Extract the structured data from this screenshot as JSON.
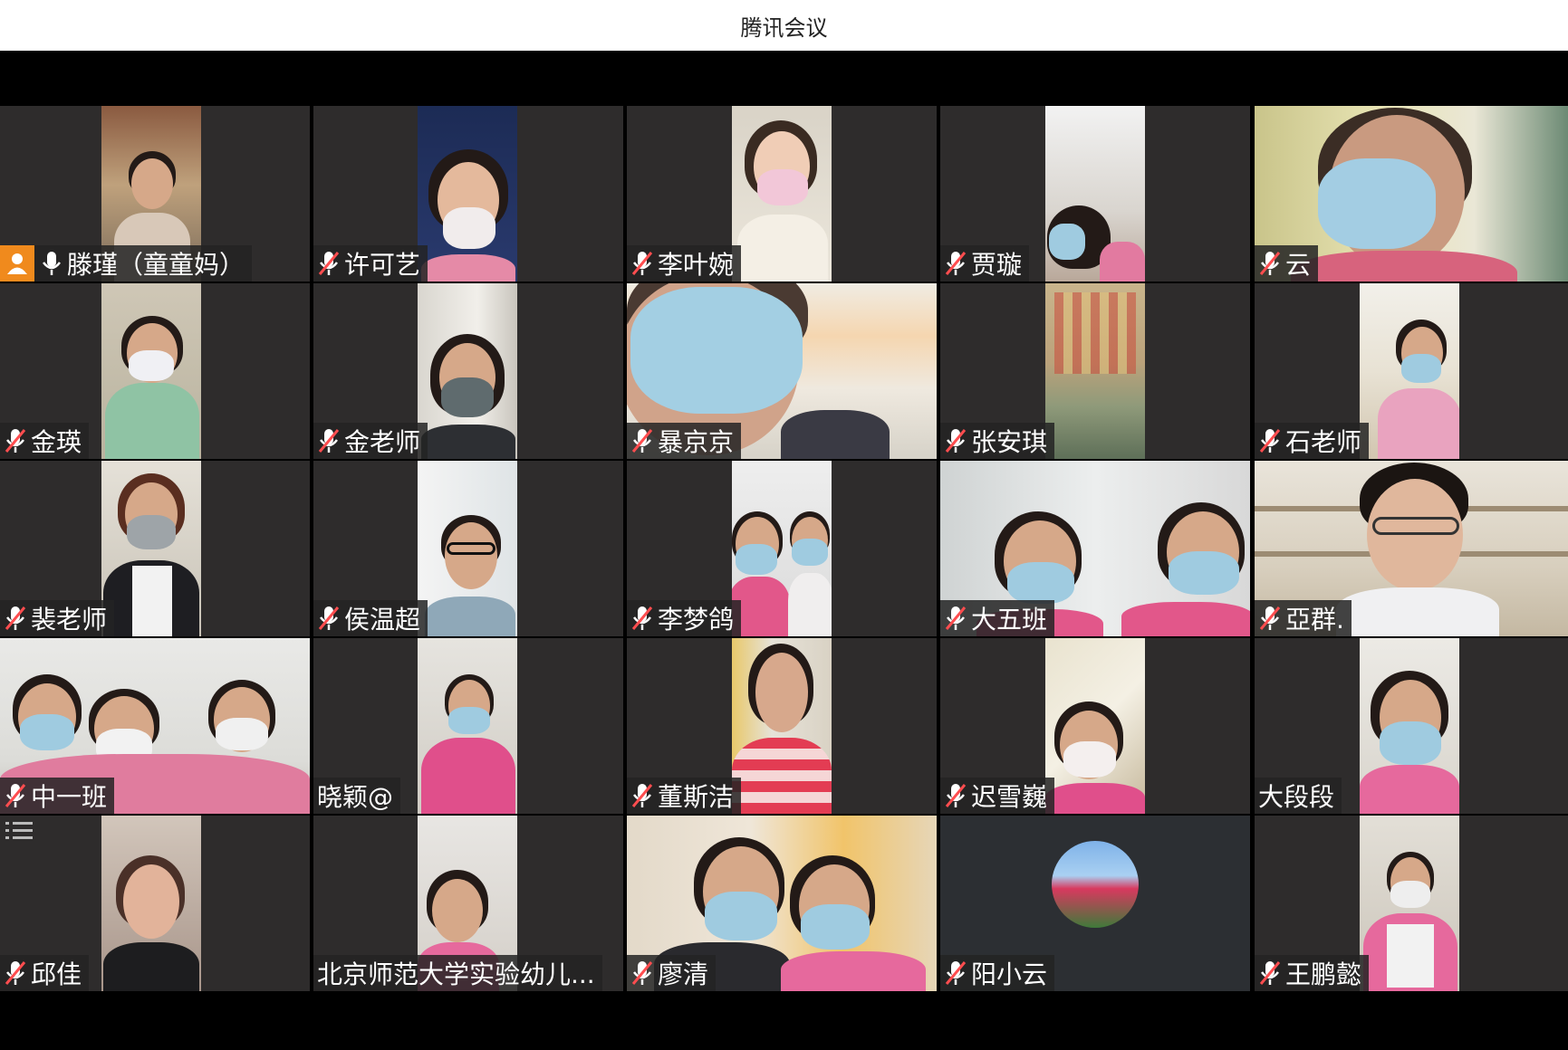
{
  "window": {
    "title": "腾讯会议"
  },
  "participants": [
    {
      "name": "滕瑾（童童妈）",
      "host": true,
      "muted": false
    },
    {
      "name": "许可艺",
      "muted": true
    },
    {
      "name": "李叶婉",
      "muted": true
    },
    {
      "name": "贾璇",
      "muted": true
    },
    {
      "name": "云",
      "muted": true
    },
    {
      "name": "金瑛",
      "muted": true
    },
    {
      "name": "金老师",
      "muted": true
    },
    {
      "name": "暴京京",
      "muted": true
    },
    {
      "name": "张安琪",
      "muted": true
    },
    {
      "name": "石老师",
      "muted": true
    },
    {
      "name": "裴老师",
      "muted": true
    },
    {
      "name": "侯温超",
      "muted": true
    },
    {
      "name": "李梦鸽",
      "muted": true
    },
    {
      "name": "大五班",
      "muted": true
    },
    {
      "name": "亞群.",
      "muted": true
    },
    {
      "name": "中一班",
      "muted": true
    },
    {
      "name": "晓颖@",
      "muted": false,
      "no_mic_icon": true
    },
    {
      "name": "董斯洁",
      "muted": true
    },
    {
      "name": "迟雪巍",
      "muted": true
    },
    {
      "name": "大段段",
      "muted": false,
      "no_mic_icon": true
    },
    {
      "name": "邱佳",
      "muted": true
    },
    {
      "name": "北京师范大学实验幼儿...",
      "muted": false,
      "no_mic_icon": true
    },
    {
      "name": "廖清",
      "muted": true
    },
    {
      "name": "阳小云",
      "muted": true,
      "avatar": true
    },
    {
      "name": "王鹏懿",
      "muted": true
    }
  ],
  "colors": {
    "host_badge": "#f08a1d",
    "tile_bg": "#2e2c2c",
    "name_bg": "#232323",
    "mask": "#9fcbe0"
  },
  "icons": {
    "host": "person-icon",
    "mic_on": "microphone-icon",
    "mic_off": "microphone-muted-icon",
    "list": "list-icon"
  }
}
